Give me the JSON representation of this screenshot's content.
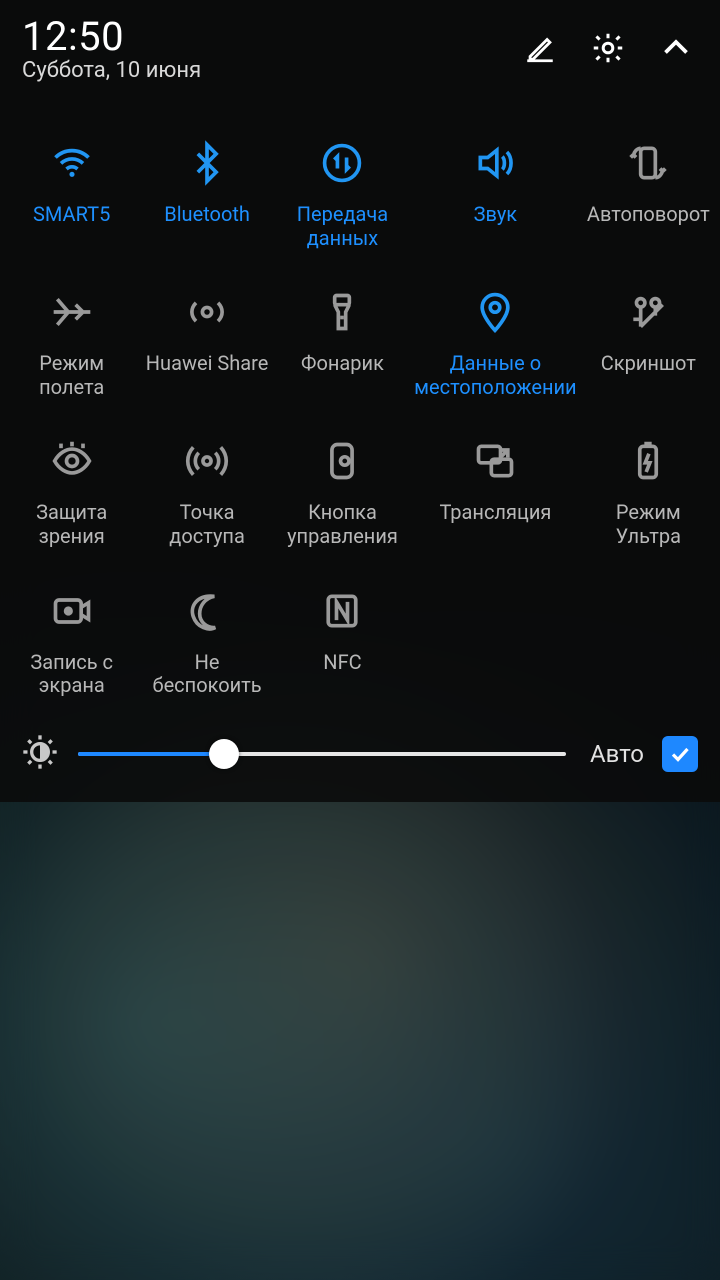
{
  "header": {
    "time": "12:50",
    "date": "Суббота, 10 июня"
  },
  "tiles": [
    {
      "label": "SMART5"
    },
    {
      "label": "Bluetooth"
    },
    {
      "label": "Передача данных"
    },
    {
      "label": "Звук"
    },
    {
      "label": "Автоповорот"
    },
    {
      "label": "Режим полета"
    },
    {
      "label": "Huawei Share"
    },
    {
      "label": "Фонарик"
    },
    {
      "label": "Данные о местоположении"
    },
    {
      "label": "Скриншот"
    },
    {
      "label": "Защита зрения"
    },
    {
      "label": "Точка доступа"
    },
    {
      "label": "Кнопка управления"
    },
    {
      "label": "Трансляция"
    },
    {
      "label": "Режим Ультра"
    },
    {
      "label": "Запись с экрана"
    },
    {
      "label": "Не беспокоить"
    },
    {
      "label": "NFC"
    }
  ],
  "brightness": {
    "percent": 30,
    "auto_label": "Авто",
    "auto_checked": true
  }
}
